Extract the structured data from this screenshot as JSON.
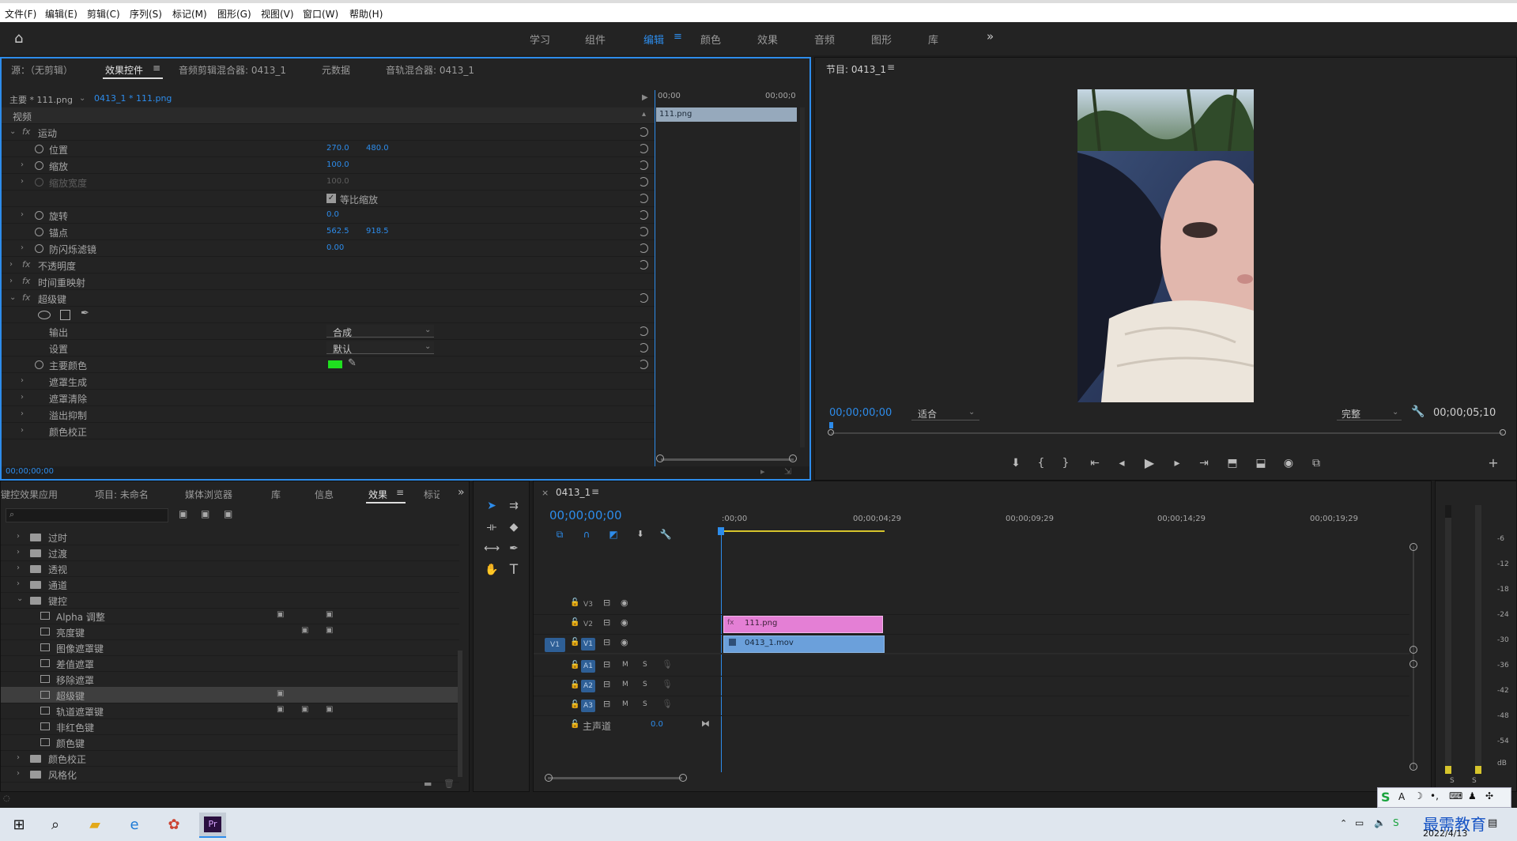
{
  "menu": [
    "文件(F)",
    "编辑(E)",
    "剪辑(C)",
    "序列(S)",
    "标记(M)",
    "图形(G)",
    "视图(V)",
    "窗口(W)",
    "帮助(H)"
  ],
  "workspaces": [
    "学习",
    "组件",
    "编辑",
    "颜色",
    "效果",
    "音频",
    "图形",
    "库"
  ],
  "active_workspace": "编辑",
  "effect_panel": {
    "tabs": [
      "源：（无剪辑）",
      "效果控件",
      "音频剪辑混合器: 0413_1",
      "元数据",
      "音轨混合器: 0413_1"
    ],
    "active_tab": "效果控件",
    "master": "主要 * 111.png",
    "seq_clip": "0413_1 * 111.png",
    "time_start": "00;00",
    "time_end": "00;00;0",
    "clip_label": "111.png",
    "video_header": "视频",
    "motion": "运动",
    "position": "位置",
    "pos_x": "270.0",
    "pos_y": "480.0",
    "scale": "缩放",
    "scale_val": "100.0",
    "scale_width": "缩放宽度",
    "scale_width_val": "100.0",
    "uniform": "等比缩放",
    "rotation": "旋转",
    "rotation_val": "0.0",
    "anchor": "锚点",
    "anchor_x": "562.5",
    "anchor_y": "918.5",
    "antiflicker": "防闪烁滤镜",
    "antiflicker_val": "0.00",
    "opacity": "不透明度",
    "timeremap": "时间重映射",
    "ultrakey": "超级键",
    "output": "输出",
    "output_val": "合成",
    "setting": "设置",
    "setting_val": "默认",
    "keycolor": "主要颜色",
    "matte_gen": "遮罩生成",
    "matte_clean": "遮罩清除",
    "spill": "溢出抑制",
    "color_correct": "颜色校正",
    "timecode": "00;00;00;00",
    "keycolor_hex": "#1fe01f"
  },
  "program": {
    "title": "节目: 0413_1",
    "timecode": "00;00;00;00",
    "fit": "适合",
    "quality": "完整",
    "duration": "00;00;05;10"
  },
  "effects_panel": {
    "tabs": [
      "键控效果应用",
      "项目: 未命名",
      "媒体浏览器",
      "库",
      "信息",
      "效果",
      "标记"
    ],
    "active_tab": "效果",
    "folders_top": [
      "过时",
      "过渡",
      "透视",
      "通道",
      "键控"
    ],
    "items": [
      "Alpha 调整",
      "亮度键",
      "图像遮罩键",
      "差值遮罩",
      "移除遮罩",
      "超级键",
      "轨道遮罩键",
      "非红色键",
      "颜色键"
    ],
    "selected": "超级键",
    "folders_bottom": [
      "颜色校正",
      "风格化"
    ]
  },
  "timeline": {
    "title": "0413_1",
    "timecode": "00;00;00;00",
    "ruler": [
      ":00;00",
      "00;00;04;29",
      "00;00;09;29",
      "00;00;14;29",
      "00;00;19;29"
    ],
    "video_tracks": [
      "V3",
      "V2",
      "V1"
    ],
    "audio_tracks": [
      "A1",
      "A2",
      "A3"
    ],
    "src_v1": "V1",
    "master": "主声道",
    "master_val": "0.0",
    "clip_v2": "111.png",
    "clip_v1": "0413_1.mov",
    "m": "M",
    "s": "S"
  },
  "audio_meter": {
    "scale": [
      "-6",
      "-12",
      "-18",
      "-24",
      "-30",
      "-36",
      "-42",
      "-48",
      "-54",
      "dB"
    ],
    "solo": [
      "S",
      "S"
    ]
  },
  "taskbar": {
    "time": "2022/4/13",
    "watermark": "最需教育"
  }
}
